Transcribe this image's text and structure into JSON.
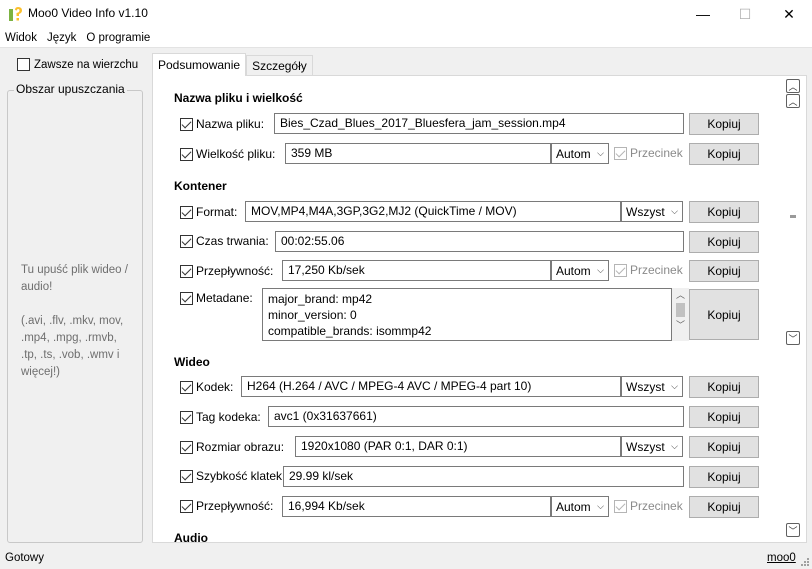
{
  "window": {
    "title": "Moo0 Video Info v1.10",
    "minimize": "—",
    "maximize": "☐",
    "close": "✕"
  },
  "menu": {
    "items": [
      "Widok",
      "Język",
      "O programie"
    ]
  },
  "left": {
    "always_on_top": "Zawsze na wierzchu",
    "dropzone_title": "Obszar upuszczania",
    "hint": "Tu upuść plik wideo / audio!",
    "formats": "(.avi, .flv, .mkv, mov, .mp4, .mpg, .rmvb, .tp, .ts, .vob, .wmv i więcej!)"
  },
  "tabs": [
    {
      "label": "Podsumowanie",
      "active": true
    },
    {
      "label": "Szczegóły",
      "active": false
    }
  ],
  "copy_label": "Kopiuj",
  "decimal_label": "Przecinek",
  "sections": {
    "file": "Nazwa pliku i wielkość",
    "container": "Kontener",
    "video": "Wideo",
    "audio": "Audio"
  },
  "rows": {
    "filename": {
      "label": "Nazwa pliku:",
      "value": "Bies_Czad_Blues_2017_Bluesfera_jam_session.mp4"
    },
    "filesize": {
      "label": "Wielkość pliku:",
      "value": "359 MB",
      "unit": "Autom"
    },
    "format": {
      "label": "Format:",
      "value": "MOV,MP4,M4A,3GP,3G2,MJ2  (QuickTime / MOV)",
      "select": "Wszyst"
    },
    "duration": {
      "label": "Czas trwania:",
      "value": "00:02:55.06"
    },
    "bitrate": {
      "label": "Przepływność:",
      "value": "17,250 Kb/sek",
      "unit": "Autom"
    },
    "metadata": {
      "label": "Metadane:",
      "lines": [
        "major_brand: mp42",
        "minor_version: 0",
        "compatible_brands: isommp42"
      ]
    },
    "codec": {
      "label": "Kodek:",
      "value": "H264  (H.264 / AVC / MPEG-4 AVC / MPEG-4 part 10)",
      "select": "Wszyst"
    },
    "codec_tag": {
      "label": "Tag kodeka:",
      "value": "avc1 (0x31637661)"
    },
    "frame_size": {
      "label": "Rozmiar obrazu:",
      "value": "1920x1080  (PAR 0:1, DAR 0:1)",
      "select": "Wszyst"
    },
    "frame_rate": {
      "label": "Szybkość klatek:",
      "value": "29.99 kl/sek"
    },
    "video_bitrate": {
      "label": "Przepływność:",
      "value": "16,994 Kb/sek",
      "unit": "Autom"
    }
  },
  "status": {
    "text": "Gotowy",
    "link": "moo0"
  },
  "colors": {
    "background": "#f0f0f0",
    "panel": "#ffffff",
    "button": "#e1e1e1",
    "disabled_text": "#8a8a8a"
  }
}
